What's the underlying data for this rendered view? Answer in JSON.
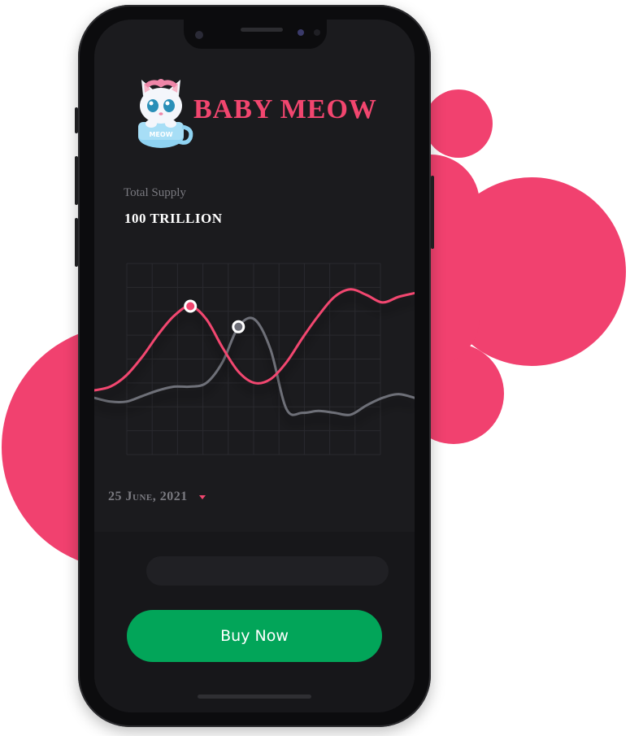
{
  "app": {
    "brand_title": "BABY MEOW",
    "logo_text": "MEOW"
  },
  "stats": {
    "supply_label": "Total Supply",
    "supply_value": "100 TRILLION"
  },
  "chart_data": {
    "type": "line",
    "title": "",
    "xlabel": "",
    "ylabel": "",
    "grid": true,
    "x": [
      0,
      1,
      2,
      3,
      4,
      5,
      6,
      7,
      8,
      9,
      10,
      11,
      12,
      13,
      14,
      15,
      16,
      17,
      18,
      19,
      20
    ],
    "ylim": [
      0,
      100
    ],
    "series": [
      {
        "color": "#f2466f",
        "values": [
          30,
          32,
          38,
          48,
          60,
          70,
          75,
          68,
          53,
          40,
          34,
          36,
          45,
          58,
          70,
          80,
          84,
          81,
          77,
          80,
          82
        ],
        "highlight_index": 6
      },
      {
        "color": "#6e6f78",
        "values": [
          26,
          24,
          24,
          27,
          30,
          32,
          32,
          34,
          45,
          64,
          68,
          52,
          20,
          18,
          19,
          18,
          17,
          22,
          26,
          28,
          26
        ],
        "highlight_index": 9
      }
    ]
  },
  "date_select": {
    "value": "25 June, 2021"
  },
  "actions": {
    "buy_label": "Buy Now"
  },
  "colors": {
    "accent": "#f2466f",
    "buy": "#02a559",
    "screen": "#1b1b1e"
  }
}
